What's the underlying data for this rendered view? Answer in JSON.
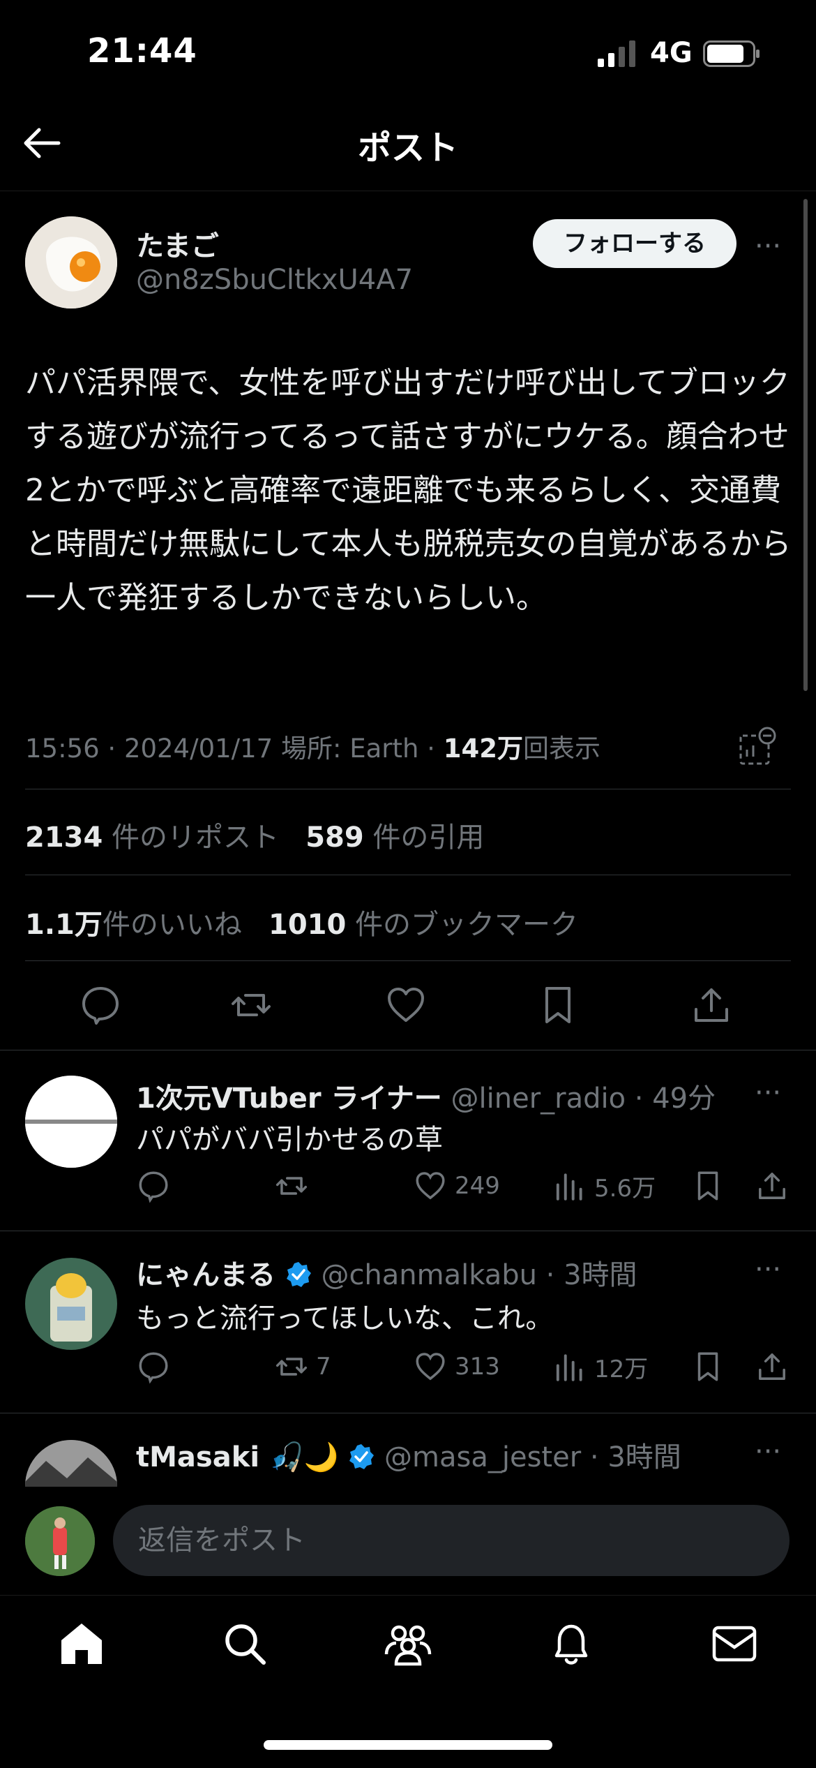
{
  "status_bar": {
    "time": "21:44",
    "network": "4G"
  },
  "header": {
    "title": "ポスト"
  },
  "post": {
    "author_name": "たまご",
    "author_handle": "@n8zSbuCltkxU4A7",
    "follow_label": "フォローする",
    "more": "···",
    "text": "パパ活界隈で、女性を呼び出すだけ呼び出してブロックする遊びが流行ってるって話さすがにウケる。顔合わせ2とかで呼ぶと高確率で遠距離でも来るらしく、交通費と時間だけ無駄にして本人も脱税売女の自覚があるから一人で発狂するしかできないらしい。",
    "time": "15:56",
    "date": "2024/01/17",
    "location": "場所: Earth",
    "views_count": "142万",
    "views_label": "回表示",
    "reposts_count": "2134",
    "reposts_label": "件のリポスト",
    "quotes_count": "589",
    "quotes_label": "件の引用",
    "likes_count": "1.1万",
    "likes_label": "件のいいね",
    "bookmarks_count": "1010",
    "bookmarks_label": "件のブックマーク"
  },
  "replies": [
    {
      "name": "1次元VTuber ライナー",
      "handle": "@liner_radio",
      "time": "49分",
      "text": "パパがババ引かせるの草",
      "reposts": "",
      "likes": "249",
      "views": "5.6万"
    },
    {
      "name": "にゃんまる",
      "handle": "@chanmalkabu",
      "time": "3時間",
      "text": "もっと流行ってほしいな、これ。",
      "reposts": "7",
      "likes": "313",
      "views": "12万"
    },
    {
      "name": "tMasaki 🎣🌙",
      "handle": "@masa_jester",
      "time": "3時間",
      "text": ""
    }
  ],
  "reply_bar": {
    "placeholder": "返信をポスト"
  },
  "icons": [
    "back-arrow-icon",
    "reply-icon",
    "repost-icon",
    "like-icon",
    "bookmark-icon",
    "share-icon",
    "views-icon",
    "verified-icon",
    "home-icon",
    "search-icon",
    "communities-icon",
    "notifications-icon",
    "messages-icon"
  ],
  "colors": {
    "background": "#000000",
    "text": "#e7e9ea",
    "muted": "#71767b",
    "verified": "#1d9bf0",
    "divider": "#2f3336"
  }
}
